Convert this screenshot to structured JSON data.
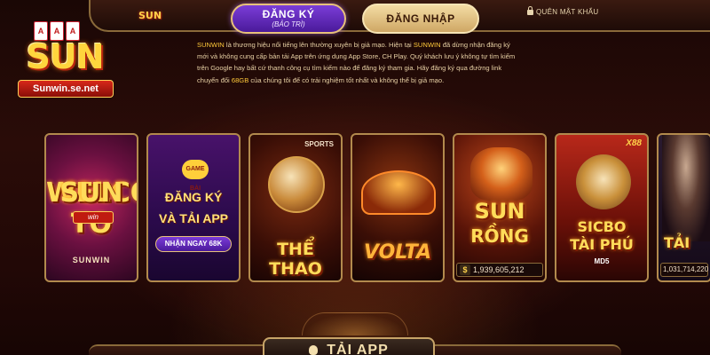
{
  "header": {
    "mini_logo": "SUN",
    "register": {
      "label": "ĐĂNG KÝ",
      "note": "(BẢO TRÌ)"
    },
    "login_label": "ĐĂNG NHẬP",
    "forgot_password": "QUÊN MẬT KHẨU"
  },
  "logo": {
    "cards": [
      "A",
      "A",
      "A"
    ],
    "wordmark": "SUN",
    "domain": "Sunwin.se.net"
  },
  "intro": {
    "parts": [
      {
        "text": "SUNWIN",
        "highlight": true
      },
      {
        "text": " là thương hiệu nổi tiếng lên thường xuyên bị giả mạo. Hiện tại ",
        "highlight": false
      },
      {
        "text": "SUNWIN",
        "highlight": true
      },
      {
        "text": " đã dừng nhận đăng ký mới và không cung cấp bản tải App trên ứng dụng App Store, CH Play. Quý khách lưu ý không tự tìm kiếm trên Google hay bất cứ thanh công cụ tìm kiếm nào để đăng ký tham gia. Hãy đăng ký qua đường link chuyển đổi ",
        "highlight": false
      },
      {
        "text": "68GB",
        "highlight": true
      },
      {
        "text": " của chúng tôi để có trải nghiệm tốt nhất và không thể bị giả mạo.",
        "highlight": false
      }
    ]
  },
  "games": {
    "welcome": {
      "welcome_text": "WELCOME TO",
      "logo_text": "SUN",
      "logo_sub": "win",
      "footer": "SUNWIN"
    },
    "register_card": {
      "badge": "GAME BÀI",
      "line1": "ĐĂNG KÝ",
      "line2": "VÀ TẢI APP",
      "cta": "NHẬN NGAY 68K"
    },
    "sports": {
      "tag": "SPORTS",
      "title": "THỂ THAO"
    },
    "volta": {
      "title": "VOLTA"
    },
    "sun_rong": {
      "title1": "SUN",
      "title2": "RỒNG",
      "jackpot_symbol": "$",
      "jackpot": "1,939,605,212"
    },
    "sicbo": {
      "badge": "X88",
      "title1": "SICBO",
      "title2": "TÀI PHÚ",
      "subtitle": "MD5"
    },
    "tai_xiu": {
      "title": "TẢI",
      "jackpot": "1,031,714,220"
    }
  },
  "footer": {
    "app_button": "TẢI APP"
  }
}
